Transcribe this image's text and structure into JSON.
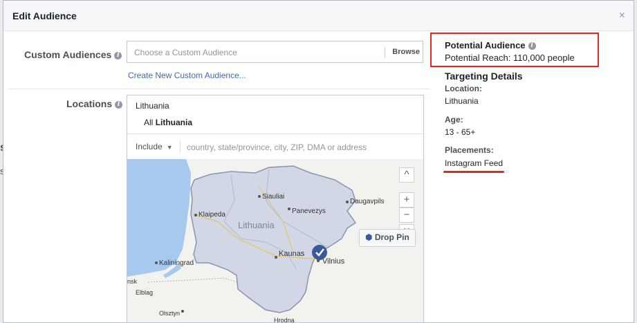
{
  "dialog": {
    "title": "Edit Audience",
    "close_symbol": "×"
  },
  "custom_audiences": {
    "label": "Custom Audiences",
    "placeholder": "Choose a Custom Audience",
    "browse_label": "Browse",
    "create_link": "Create New Custom Audience..."
  },
  "locations": {
    "label": "Locations",
    "country": "Lithuania",
    "all_prefix": "All",
    "all_country": "Lithuania",
    "include_label": "Include",
    "search_placeholder": "country, state/province, city, ZIP, DMA or address",
    "drop_pin_label": "Drop Pin",
    "map": {
      "country_label": "Lithuania",
      "cities": [
        "Siauliai",
        "Klaipeda",
        "Panevezys",
        "Kaunas",
        "Vilnius",
        "Daugavpils",
        "Kaliningrad",
        "Elblag",
        "Olsztyn",
        "Hrodna",
        "nsk"
      ]
    }
  },
  "potential_audience": {
    "title": "Potential Audience",
    "reach": "Potential Reach: 110,000 people"
  },
  "targeting": {
    "title": "Targeting Details",
    "location_label": "Location:",
    "location_value": "Lithuania",
    "age_label": "Age:",
    "age_value": "13 - 65+",
    "placements_label": "Placements:",
    "placements_value": "Instagram Feed"
  },
  "colors": {
    "accent": "#4267b2",
    "highlight": "#e8251a",
    "map_water": "#a7c9ee",
    "map_land": "#f2f2ee",
    "map_region": "#d2d7e6",
    "pin": "#3b5998"
  }
}
